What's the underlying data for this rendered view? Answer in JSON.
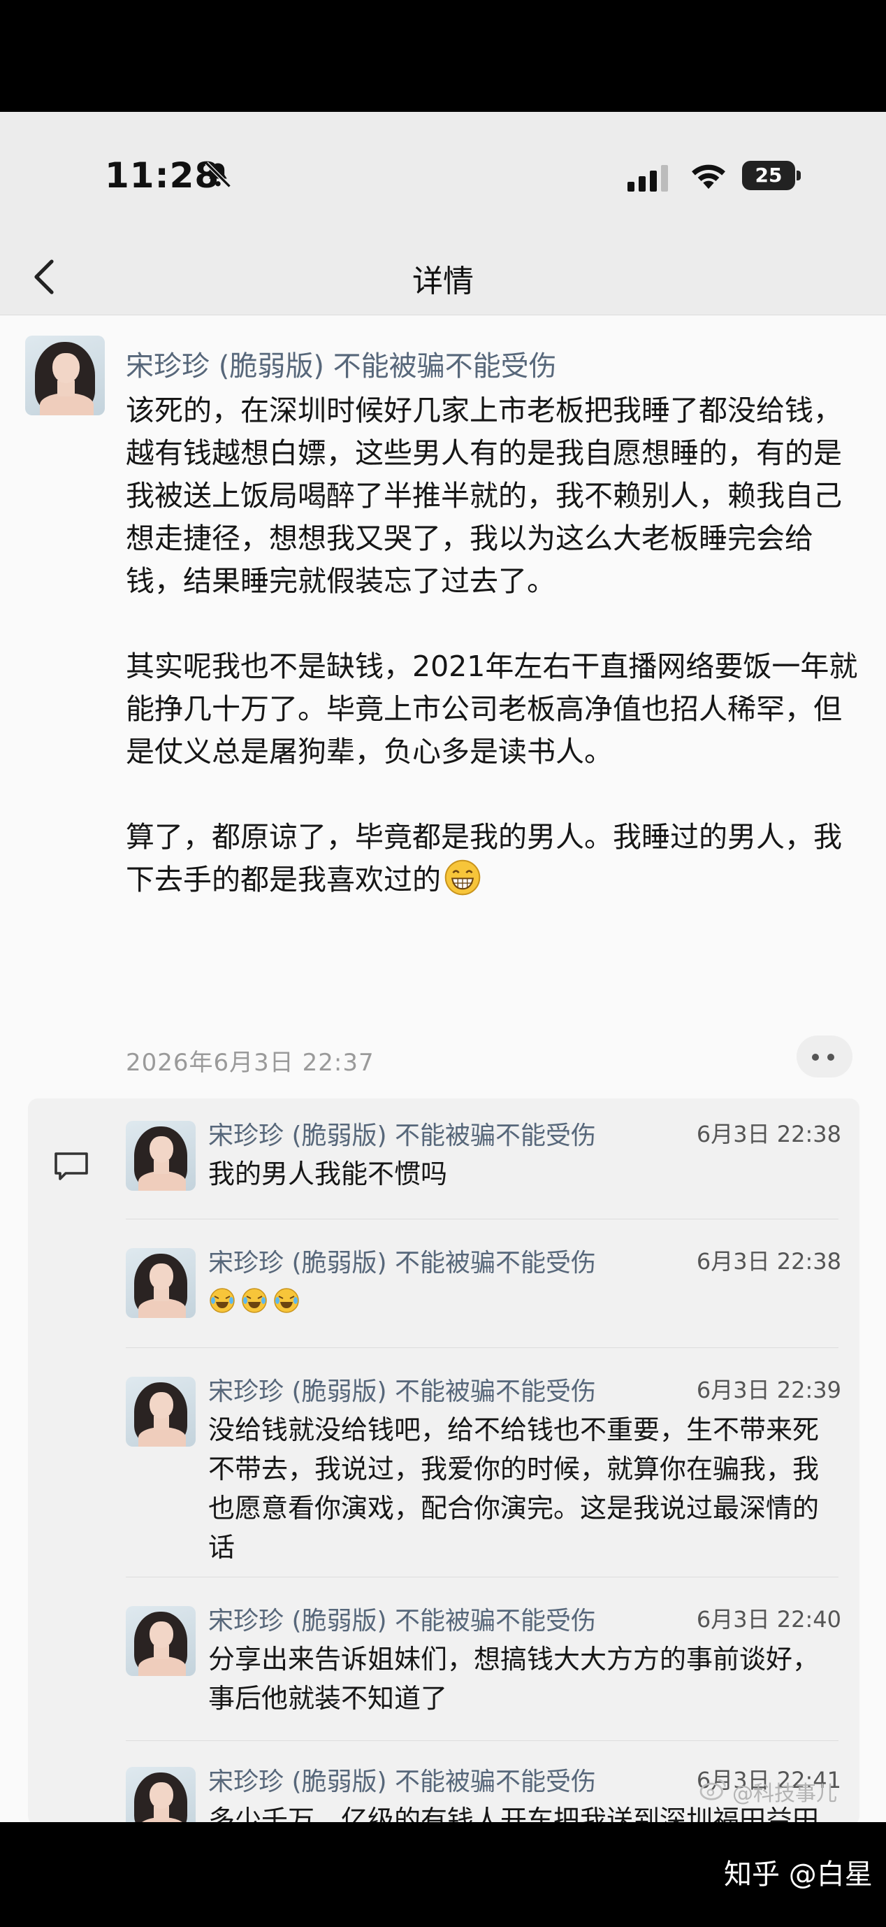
{
  "status_bar": {
    "time": "11:28",
    "battery": "25"
  },
  "nav": {
    "title": "详情"
  },
  "post": {
    "author": "宋珍珍 (脆弱版) 不能被骗不能受伤",
    "paragraphs": [
      "该死的，在深圳时候好几家上市老板把我睡了都没给钱，越有钱越想白嫖，这些男人有的是我自愿想睡的，有的是我被送上饭局喝醉了半推半就的，我不赖别人，赖我自己想走捷径，想想我又哭了，我以为这么大老板睡完会给钱，结果睡完就假装忘了过去了。",
      "其实呢我也不是缺钱，2021年左右干直播网络要饭一年就能挣几十万了。毕竟上市公司老板高净值也招人稀罕，但是仗义总是屠狗辈，负心多是读书人。",
      "算了，都原谅了，毕竟都是我的男人。我睡过的男人，我下去手的都是我喜欢过的"
    ],
    "timestamp": "2026年6月3日 22:37"
  },
  "comments": [
    {
      "author": "宋珍珍 (脆弱版) 不能被骗不能受伤",
      "time": "6月3日 22:38",
      "text": "我的男人我能不惯吗"
    },
    {
      "author": "宋珍珍 (脆弱版) 不能被骗不能受伤",
      "time": "6月3日 22:38",
      "text": "",
      "emoji": [
        "crying-laughing-emoji",
        "crying-laughing-emoji",
        "crying-laughing-emoji"
      ]
    },
    {
      "author": "宋珍珍 (脆弱版) 不能被骗不能受伤",
      "time": "6月3日 22:39",
      "text": "没给钱就没给钱吧，给不给钱也不重要，生不带来死不带去，我说过，我爱你的时候，就算你在骗我，我也愿意看你演戏，配合你演完。这是我说过最深情的话"
    },
    {
      "author": "宋珍珍 (脆弱版) 不能被骗不能受伤",
      "time": "6月3日 22:40",
      "text": "分享出来告诉姐妹们，想搞钱大大方方的事前谈好，事后他就装不知道了"
    },
    {
      "author": "宋珍珍 (脆弱版) 不能被骗不能受伤",
      "time": "6月3日 22:41",
      "text": "多少千万，亿级的有钱人开车把我送到深圳福田益田花园一栋楼下，要把我送上楼，说要去我家喝杯咖啡"
    }
  ],
  "watermark": "@科技事儿",
  "footer": {
    "credit": "知乎 @白星"
  }
}
